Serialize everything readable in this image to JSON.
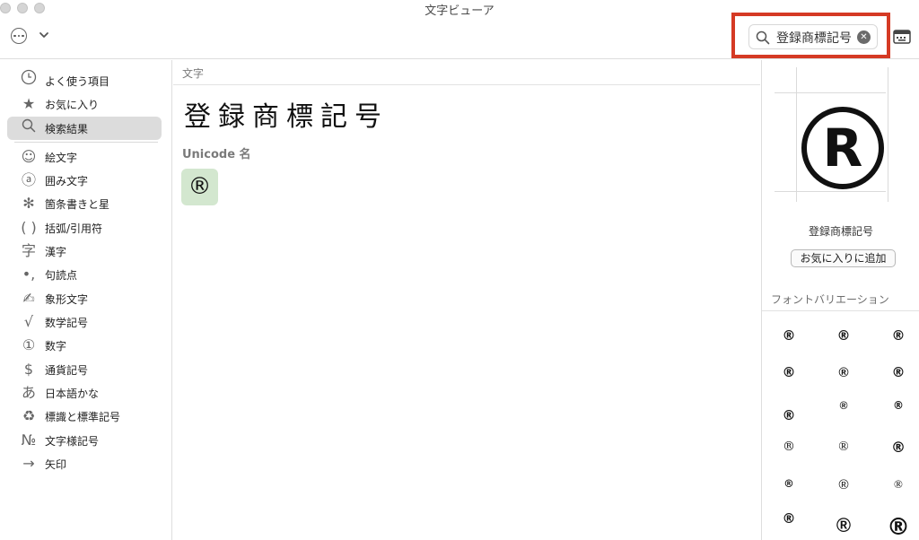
{
  "window": {
    "title": "文字ビューア"
  },
  "toolbar": {
    "more_icon": "ellipsis-circle-icon",
    "chevron_icon": "chevron-down-icon",
    "keyboard_icon": "keyboard-viewer-icon"
  },
  "search": {
    "value": "登録商標記号",
    "search_icon": "magnifier-icon",
    "clear_icon": "clear-icon",
    "highlight_color": "#d53a24"
  },
  "sidebar": {
    "items": [
      {
        "label": "よく使う項目",
        "glyph": "🕘",
        "icon": "clock-icon"
      },
      {
        "label": "お気に入り",
        "glyph": "★",
        "icon": "star-icon"
      },
      {
        "label": "検索結果",
        "glyph": "🔍",
        "icon": "search-icon",
        "selected": true
      },
      {
        "label": "絵文字",
        "glyph": "☺",
        "icon": "smiley-icon"
      },
      {
        "label": "囲み文字",
        "glyph": "ⓐ",
        "icon": "circled-a-icon"
      },
      {
        "label": "箇条書きと星",
        "glyph": "✻",
        "icon": "asterisk-icon"
      },
      {
        "label": "括弧/引用符",
        "glyph": "( )",
        "icon": "parentheses-icon"
      },
      {
        "label": "漢字",
        "glyph": "字",
        "icon": "kanji-icon"
      },
      {
        "label": "句読点",
        "glyph": "•,",
        "icon": "punctuation-icon"
      },
      {
        "label": "象形文字",
        "glyph": "✍",
        "icon": "pictograph-icon"
      },
      {
        "label": "数学記号",
        "glyph": "√",
        "icon": "square-root-icon"
      },
      {
        "label": "数字",
        "glyph": "①",
        "icon": "circled-one-icon"
      },
      {
        "label": "通貨記号",
        "glyph": "$",
        "icon": "dollar-icon"
      },
      {
        "label": "日本語かな",
        "glyph": "あ",
        "icon": "hiragana-a-icon"
      },
      {
        "label": "標識と標準記号",
        "glyph": "♻",
        "icon": "recycle-icon"
      },
      {
        "label": "文字様記号",
        "glyph": "№",
        "icon": "numero-icon"
      },
      {
        "label": "矢印",
        "glyph": "→",
        "icon": "arrow-right-icon"
      }
    ]
  },
  "main": {
    "section_header": "文字",
    "big_text": "登録商標記号",
    "unicode_name_label": "Unicode 名",
    "result_char": "®"
  },
  "detail": {
    "preview_glyph": "R",
    "char_name": "登録商標記号",
    "favorite_button": "お気に入りに追加",
    "variations_label": "フォントバリエーション",
    "variation_glyph": "®",
    "variation_count": 18
  }
}
